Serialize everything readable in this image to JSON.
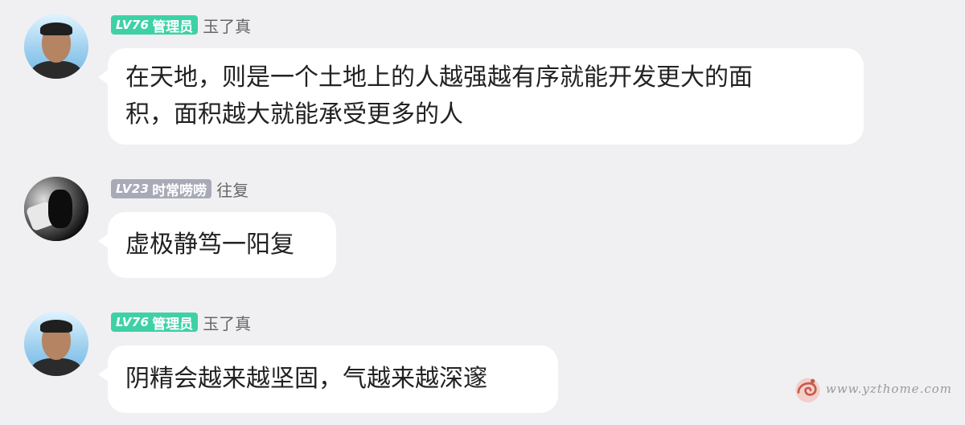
{
  "messages": [
    {
      "level": "LV76",
      "role": "管理员",
      "username": "玉了真",
      "badge_color": "#3fd1a6",
      "text_line1": "在天地，则是一个土地上的人越强越有序就能开发更大的面",
      "text_line2": "积，面积越大就能承受更多的人"
    },
    {
      "level": "LV23",
      "role": "时常唠唠",
      "username": "往复",
      "badge_color": "#a9aab8",
      "text_line1": "虚极静笃一阳复"
    },
    {
      "level": "LV76",
      "role": "管理员",
      "username": "玉了真",
      "badge_color": "#3fd1a6",
      "text_line1": "阴精会越来越坚固，气越来越深邃"
    }
  ],
  "watermark": {
    "text": "www.yzthome.com",
    "logo_icon": "swirl-logo-icon"
  }
}
